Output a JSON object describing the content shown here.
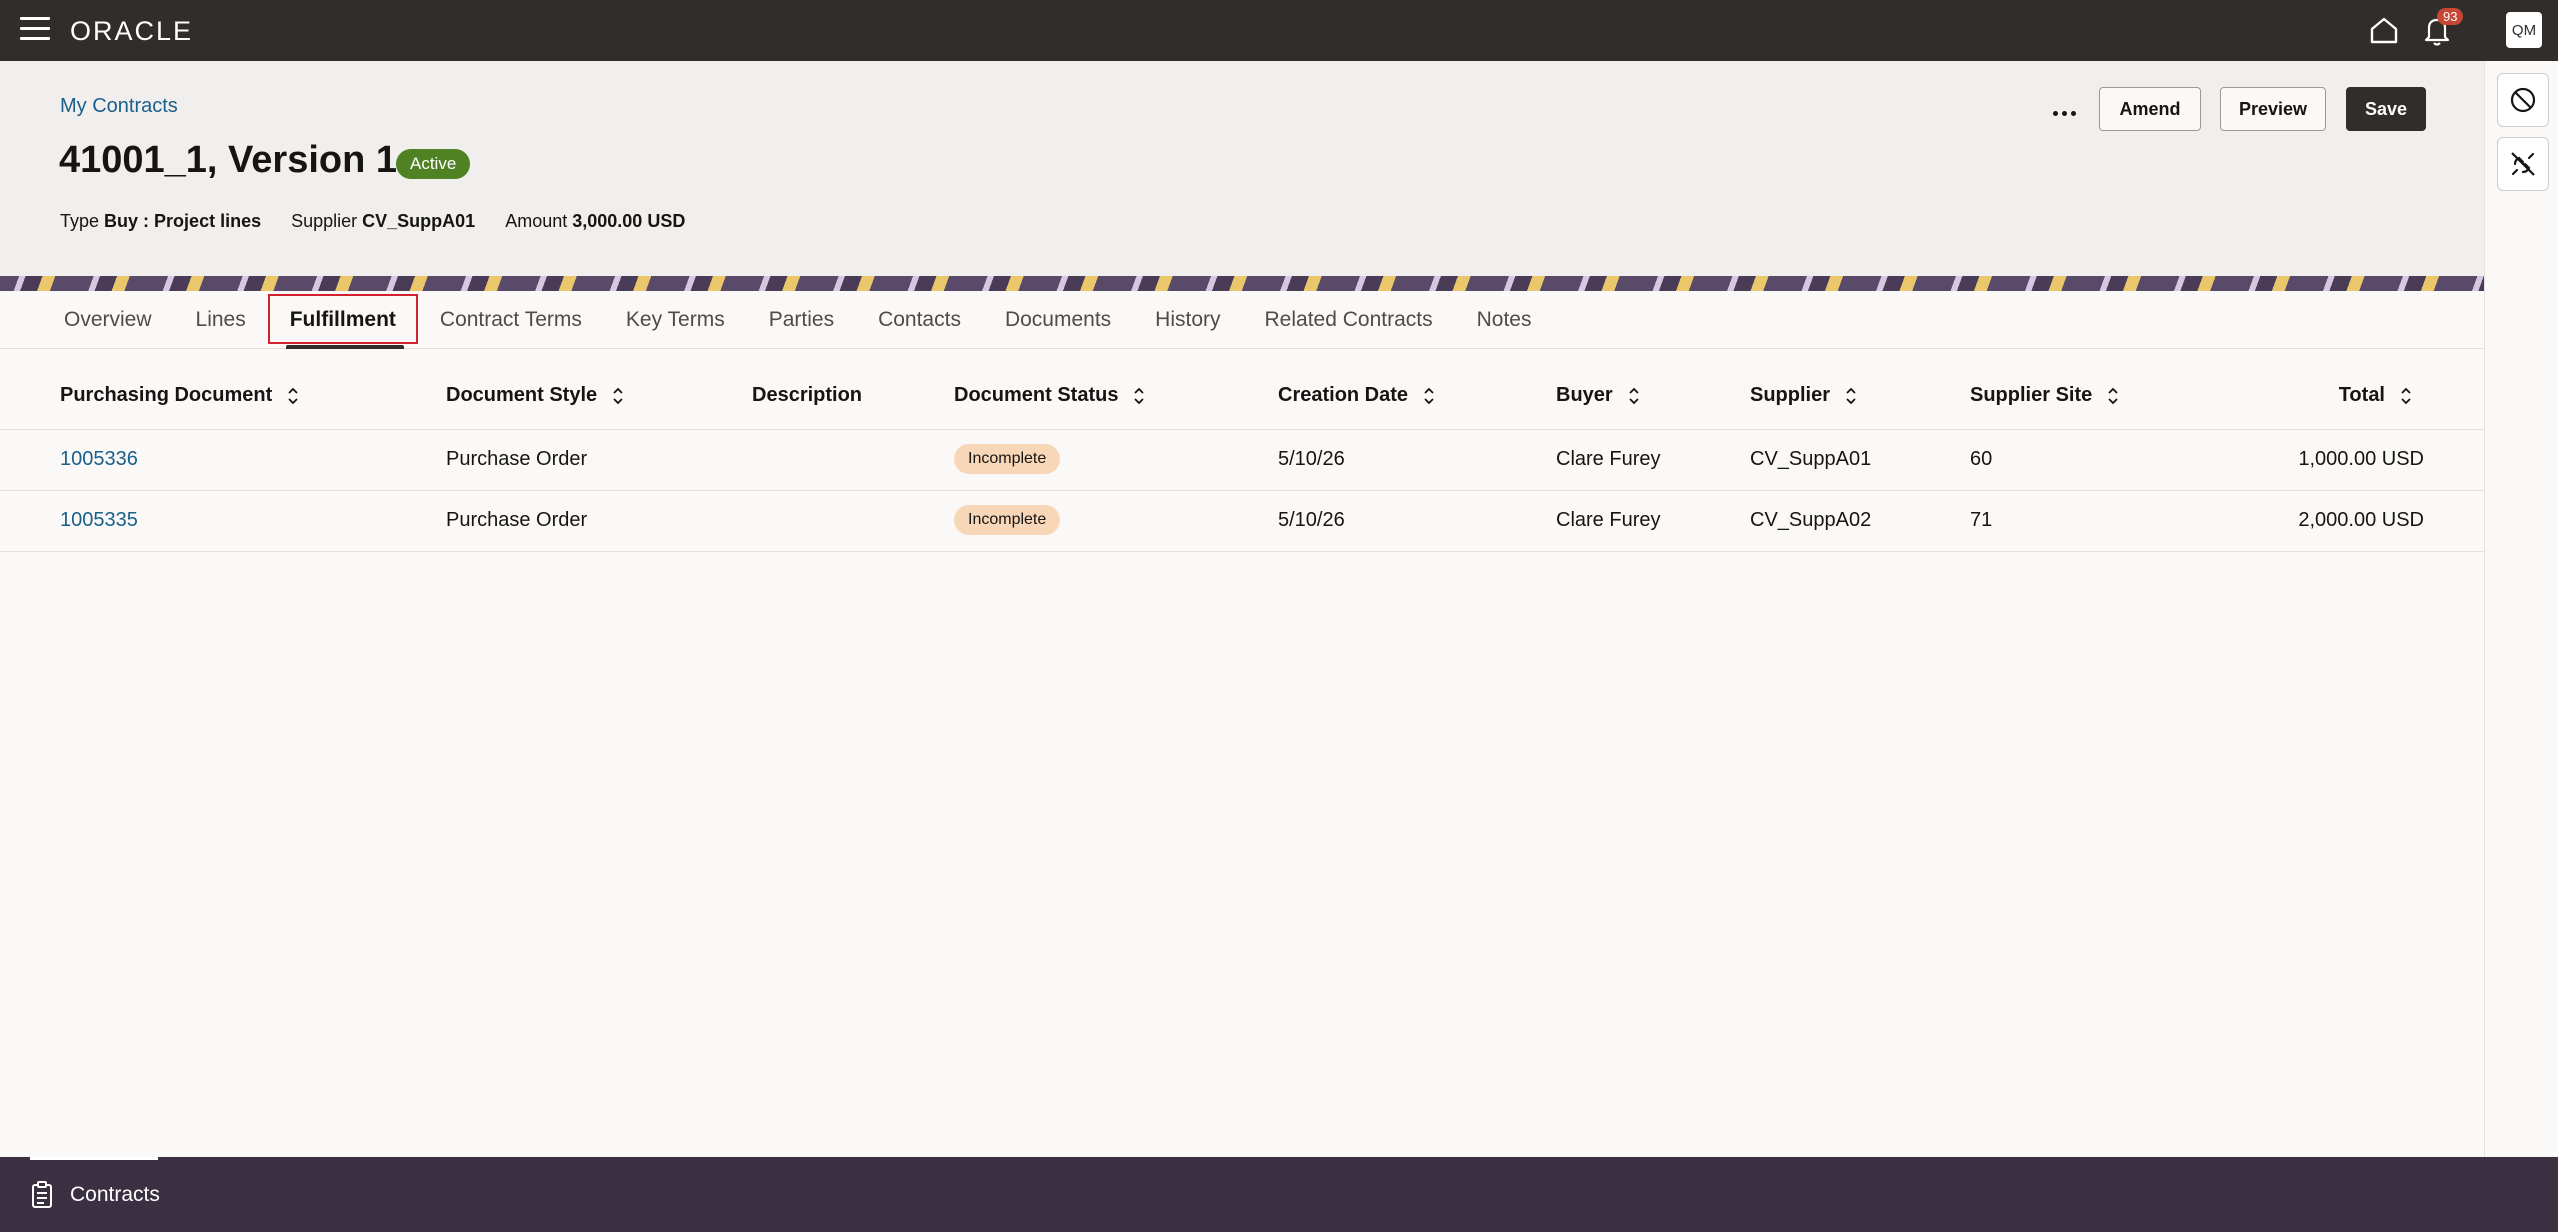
{
  "topbar": {
    "logo": "ORACLE",
    "notification_count": "93",
    "user_initials": "QM"
  },
  "header": {
    "breadcrumb": "My Contracts",
    "title": "41001_1, Version 1",
    "status": "Active",
    "type_label": "Type",
    "type_value": "Buy : Project lines",
    "supplier_label": "Supplier",
    "supplier_value": "CV_SuppA01",
    "amount_label": "Amount",
    "amount_value": "3,000.00 USD",
    "actions": {
      "amend": "Amend",
      "preview": "Preview",
      "save": "Save"
    }
  },
  "tabs": [
    "Overview",
    "Lines",
    "Fulfillment",
    "Contract Terms",
    "Key Terms",
    "Parties",
    "Contacts",
    "Documents",
    "History",
    "Related Contracts",
    "Notes"
  ],
  "active_tab": "Fulfillment",
  "table": {
    "columns": [
      "Purchasing Document",
      "Document Style",
      "Description",
      "Document Status",
      "Creation Date",
      "Buyer",
      "Supplier",
      "Supplier Site",
      "Total"
    ],
    "rows": [
      {
        "purchasing_document": "1005336",
        "document_style": "Purchase Order",
        "description": "",
        "document_status": "Incomplete",
        "creation_date": "5/10/26",
        "buyer": "Clare Furey",
        "supplier": "CV_SuppA01",
        "supplier_site": "60",
        "total": "1,000.00 USD"
      },
      {
        "purchasing_document": "1005335",
        "document_style": "Purchase Order",
        "description": "",
        "document_status": "Incomplete",
        "creation_date": "5/10/26",
        "buyer": "Clare Furey",
        "supplier": "CV_SuppA02",
        "supplier_site": "71",
        "total": "2,000.00 USD"
      }
    ]
  },
  "bottombar": {
    "tab_label": "Contracts"
  },
  "colors": {
    "topbar": "#312d2a",
    "active_badge": "#508223",
    "link": "#1a5f8a",
    "incomplete_pill": "#f8d6b8",
    "focus_outline": "#d0222f",
    "bottombar": "#3a3042"
  }
}
